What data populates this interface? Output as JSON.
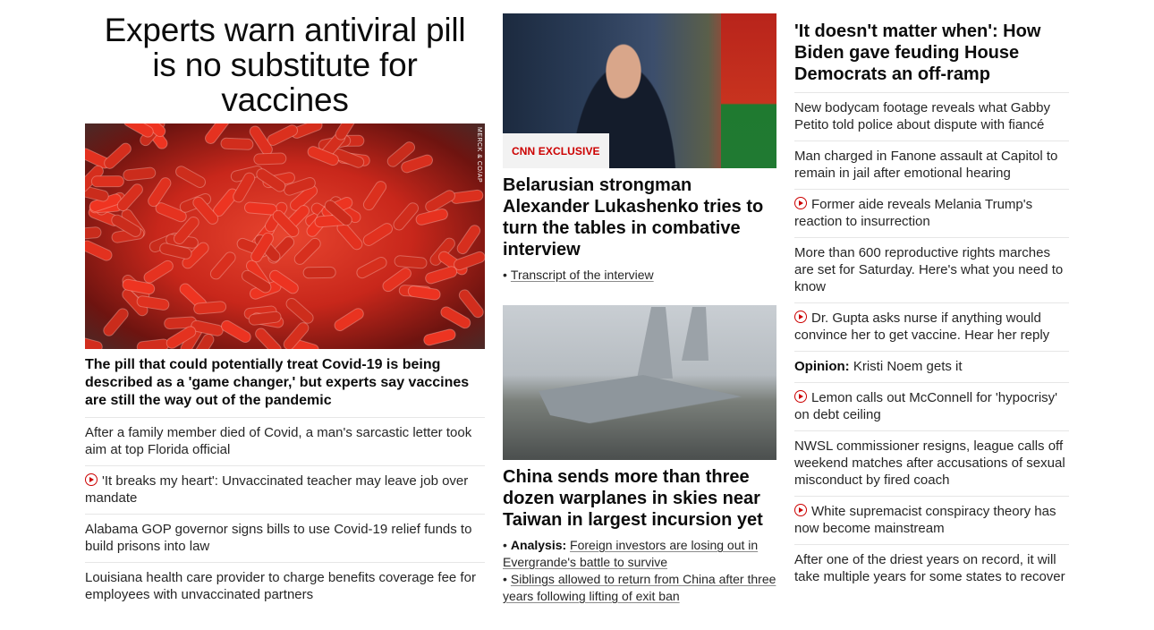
{
  "lead": {
    "title": "Experts warn antiviral pill is no substitute for vaccines",
    "image_credit": "MERCK & CO/AP",
    "subtitle": "The pill that could potentially treat Covid-19 is being described as a 'game changer,' but experts say vaccines are still the way out of the pandemic",
    "items": [
      {
        "text": "After a family member died of Covid, a man's sarcastic letter took aim at top Florida official",
        "video": false
      },
      {
        "text": "'It breaks my heart': Unvaccinated teacher may leave job over mandate",
        "video": true
      },
      {
        "text": "Alabama GOP governor signs bills to use Covid-19 relief funds to build prisons into law",
        "video": false
      },
      {
        "text": "Louisiana health care provider to charge benefits coverage fee for employees with unvaccinated partners",
        "video": false
      }
    ]
  },
  "middle": {
    "card1": {
      "badge": "CNN EXCLUSIVE",
      "title": "Belarusian strongman Alexander Lukashenko tries to turn the tables in combative interview",
      "links": [
        {
          "kicker": "",
          "text": "Transcript of the interview"
        }
      ]
    },
    "card2": {
      "title": "China sends more than three dozen warplanes in skies near Taiwan in largest incursion yet",
      "links": [
        {
          "kicker": "Analysis:",
          "text": "Foreign investors are losing out in Evergrande's battle to survive"
        },
        {
          "kicker": "",
          "text": "Siblings allowed to return from China after three years following lifting of exit ban"
        }
      ]
    }
  },
  "right": {
    "title": "'It doesn't matter when': How Biden gave feuding House Democrats an off-ramp",
    "items": [
      {
        "kicker": "",
        "text": "New bodycam footage reveals what Gabby Petito told police about dispute with fiancé",
        "video": false
      },
      {
        "kicker": "",
        "text": "Man charged in Fanone assault at Capitol to remain in jail after emotional hearing",
        "video": false
      },
      {
        "kicker": "",
        "text": "Former aide reveals Melania Trump's reaction to insurrection",
        "video": true
      },
      {
        "kicker": "",
        "text": "More than 600 reproductive rights marches are set for Saturday. Here's what you need to know",
        "video": false
      },
      {
        "kicker": "",
        "text": "Dr. Gupta asks nurse if anything would convince her to get vaccine. Hear her reply",
        "video": true
      },
      {
        "kicker": "Opinion:",
        "text": "Kristi Noem gets it",
        "video": false
      },
      {
        "kicker": "",
        "text": "Lemon calls out McConnell for 'hypocrisy' on debt ceiling",
        "video": true
      },
      {
        "kicker": "",
        "text": "NWSL commissioner resigns, league calls off weekend matches after accusations of sexual misconduct by fired coach",
        "video": false
      },
      {
        "kicker": "",
        "text": "White supremacist conspiracy theory has now become mainstream",
        "video": true
      },
      {
        "kicker": "",
        "text": "After one of the driest years on record, it will take multiple years for some states to recover",
        "video": false
      }
    ]
  },
  "colors": {
    "accent": "#cc0000",
    "divider": "#e6e6e6"
  }
}
